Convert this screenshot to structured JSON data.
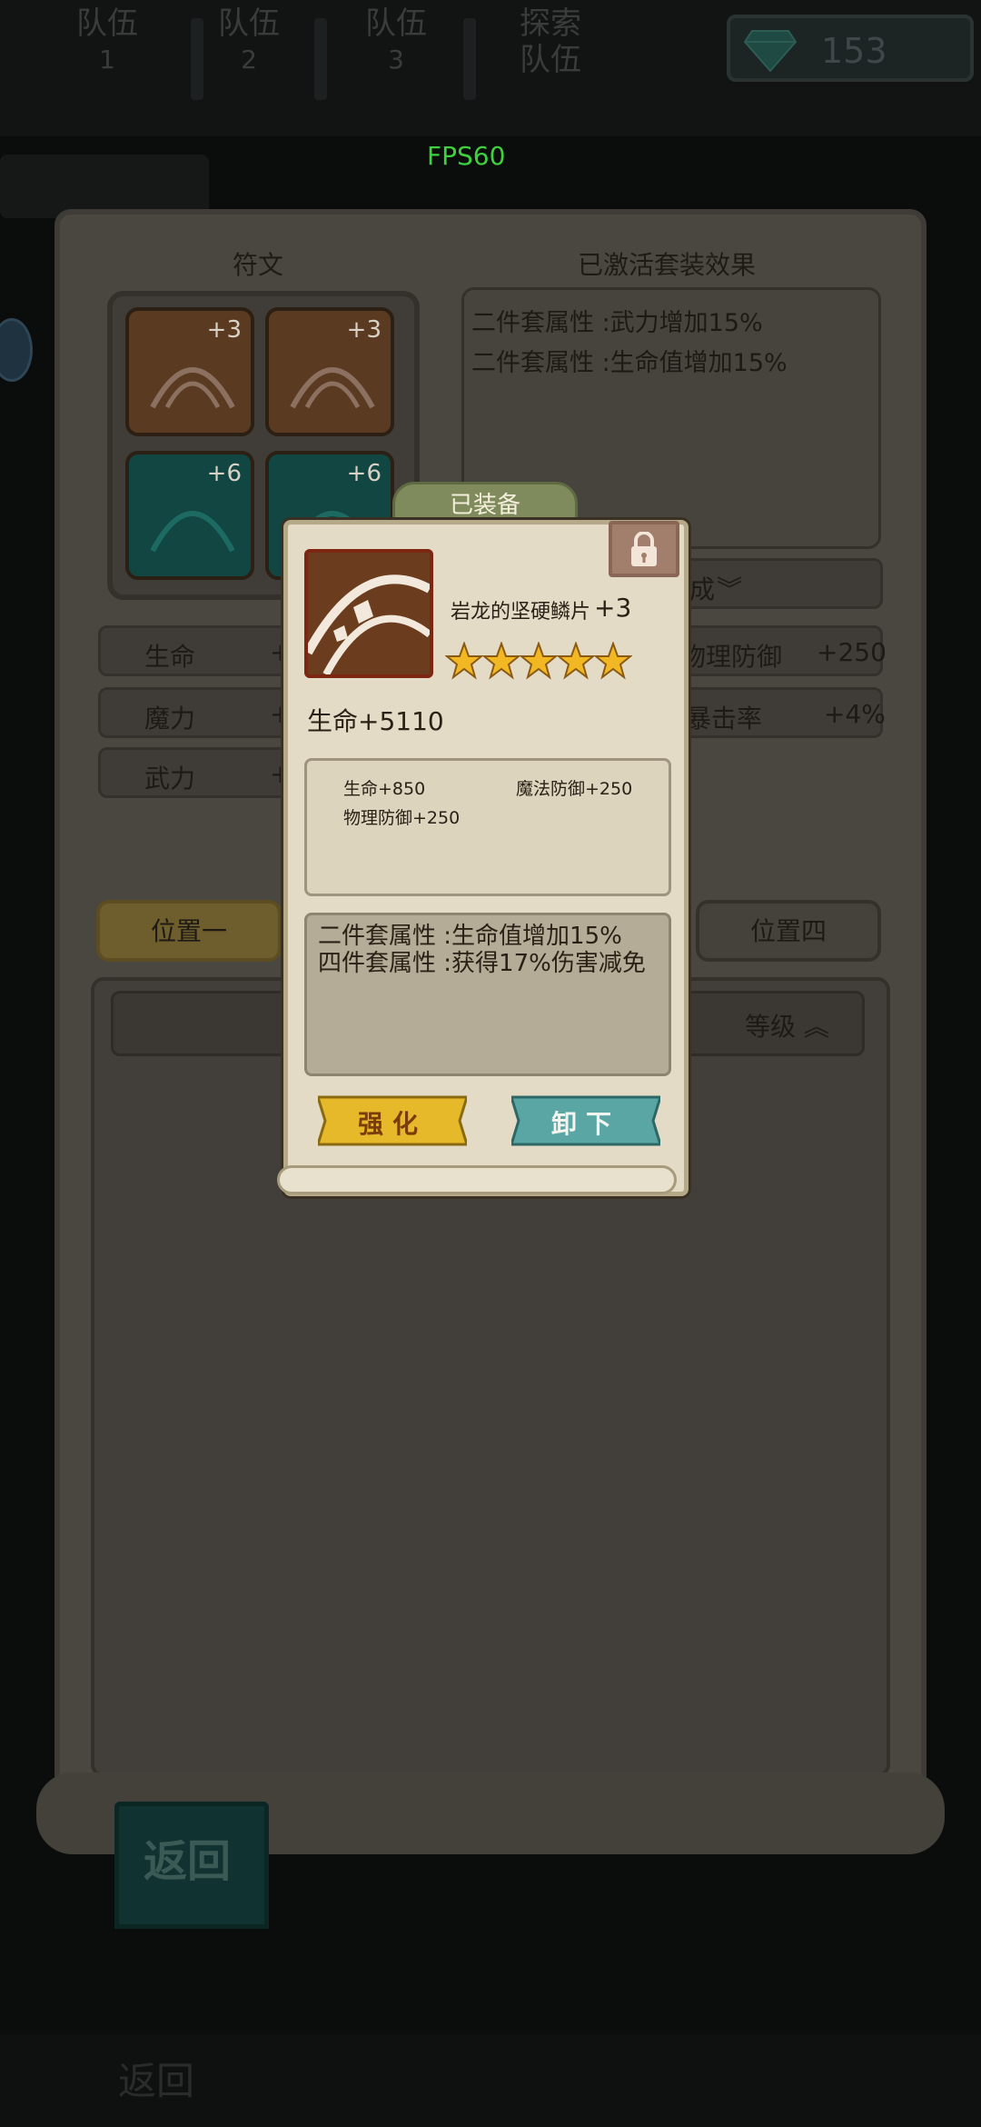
{
  "topbar": {
    "tabs": [
      {
        "label": "队伍",
        "num": "1"
      },
      {
        "label": "队伍",
        "num": "2"
      },
      {
        "label": "队伍",
        "num": "3"
      },
      {
        "label": "探索",
        "num": "队伍"
      }
    ],
    "gem_count": "153",
    "gem_icon": "diamond-icon"
  },
  "fps": "FPS60",
  "background": {
    "rune_title": "符文",
    "set_title": "已激活套装效果",
    "runes": [
      {
        "level": "+3",
        "color": "brown"
      },
      {
        "level": "+3",
        "color": "brown"
      },
      {
        "level": "+6",
        "color": "teal"
      },
      {
        "level": "+6",
        "color": "teal"
      }
    ],
    "set_effects": [
      "二件套属性 :武力增加15%",
      "二件套属性 :生命值增加15%"
    ],
    "filter_label": "成",
    "stats_left": [
      {
        "label": "生命",
        "value": "+"
      },
      {
        "label": "魔力",
        "value": "+"
      },
      {
        "label": "武力",
        "value": "+"
      }
    ],
    "stats_right": [
      {
        "label": "物理防御",
        "value": "+250"
      },
      {
        "label": "暴击率",
        "value": "+4%"
      }
    ],
    "positions": [
      "位置一",
      "位置四"
    ],
    "sort_label": "等级",
    "back_label": "返回",
    "bottom_back": "返回"
  },
  "modal": {
    "tab_label": "已装备",
    "item_name": "岩龙的坚硬鳞片",
    "item_level": "+3",
    "stars": 5,
    "main_stat": "生命+5110",
    "sub_stats": [
      "生命+850",
      "魔法防御+250",
      "物理防御+250"
    ],
    "set_desc": [
      "二件套属性 :生命值增加15%",
      "四件套属性 :获得17%伤害减免"
    ],
    "strengthen_label": "强化",
    "unequip_label": "卸下"
  },
  "colors": {
    "fps_green": "#3ed13e",
    "gold_button": "#e6b92a",
    "teal_button": "#59a6a4",
    "star_gold": "#f1b824"
  }
}
